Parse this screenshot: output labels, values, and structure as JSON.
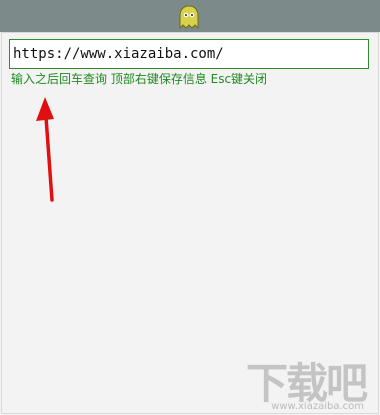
{
  "window": {
    "title_icon": "ghost-icon",
    "titlebar_color": "#7d8a8a",
    "accent_color": "#1f8a1f"
  },
  "search": {
    "value": "https://www.xiazaiba.com/"
  },
  "hint": {
    "text": "输入之后回车查询 顶部右键保存信息 Esc键关闭"
  },
  "watermark": {
    "big": "下载吧",
    "small": "www.xiazaiba.com"
  }
}
